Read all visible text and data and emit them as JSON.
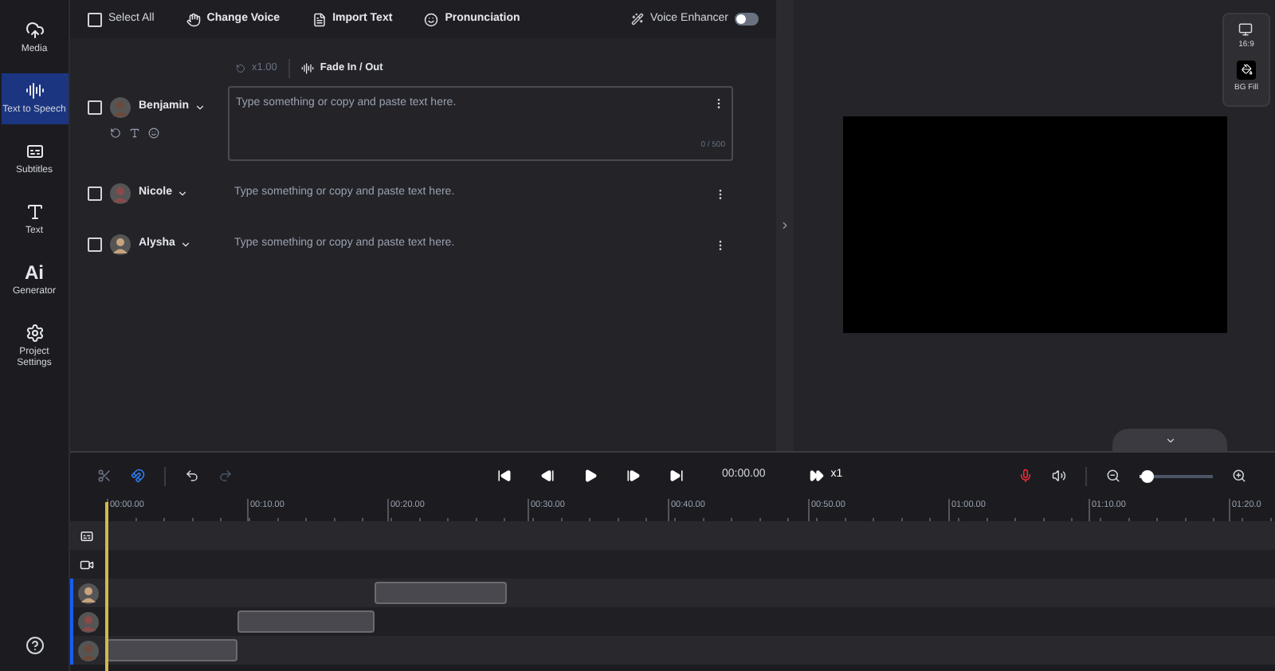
{
  "sidebar": {
    "items": [
      {
        "kind": "media",
        "label": "Media",
        "selected": false
      },
      {
        "kind": "tts",
        "label": "Text to Speech",
        "selected": true
      },
      {
        "kind": "subtitles",
        "label": "Subtitles",
        "selected": false
      },
      {
        "kind": "text",
        "label": "Text",
        "selected": false
      },
      {
        "kind": "ai",
        "label": "Generator",
        "glyph": "Ai",
        "selected": false
      },
      {
        "kind": "settings",
        "label": "Project Settings",
        "selected": false
      }
    ]
  },
  "toolbar": {
    "select_all": {
      "label": "Select All",
      "checked": false
    },
    "buttons": [
      {
        "kind": "voice",
        "label": "Change Voice"
      },
      {
        "kind": "import",
        "label": "Import Text"
      },
      {
        "kind": "pron",
        "label": "Pronunciation"
      }
    ],
    "voice_enhancer": {
      "label": "Voice Enhancer",
      "on": false
    }
  },
  "controls": {
    "speed": "x1.00",
    "fade": "Fade In / Out"
  },
  "voices": [
    {
      "name": "Benjamin",
      "checked": false,
      "expanded": true,
      "placeholder": "Type something or copy and paste text here.",
      "counter": "0 / 500"
    },
    {
      "name": "Nicole",
      "checked": false,
      "expanded": false,
      "placeholder": "Type something or copy and paste text here."
    },
    {
      "name": "Alysha",
      "checked": false,
      "expanded": false,
      "placeholder": "Type something or copy and paste text here."
    }
  ],
  "preview": {
    "ratio": "16:9",
    "bg_fill": "BG Fill"
  },
  "timeline": {
    "time": "00:00.00",
    "speed": "x1",
    "zoom": {
      "level": 0.1
    },
    "ruler": [
      "00:00.00",
      "00:10.00",
      "00:20.00",
      "00:30.00",
      "00:40.00",
      "00:50.00",
      "01:00.00",
      "01:10.00",
      "01:20.0"
    ],
    "tracks": [
      {
        "kind": "subtitle"
      },
      {
        "kind": "video"
      },
      {
        "kind": "voice"
      },
      {
        "kind": "voice"
      },
      {
        "kind": "voice"
      }
    ]
  }
}
